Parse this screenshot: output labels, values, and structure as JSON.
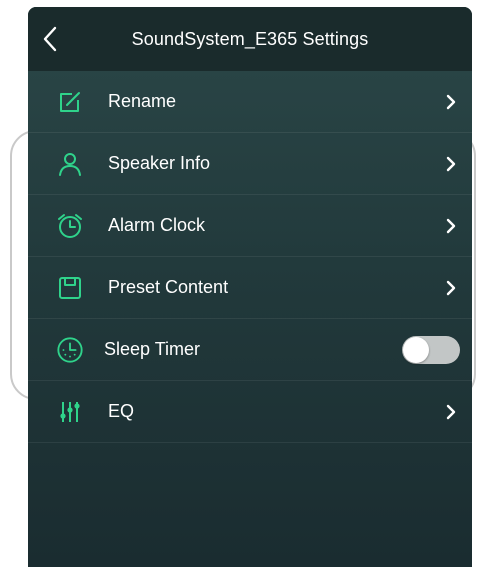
{
  "header": {
    "back_icon": "chevron-left-icon",
    "title": "SoundSystem_E365 Settings"
  },
  "accent_color": "#2fd38b",
  "items": [
    {
      "label": "Rename",
      "icon": "edit-icon",
      "control": "chevron"
    },
    {
      "label": "Speaker Info",
      "icon": "person-icon",
      "control": "chevron"
    },
    {
      "label": "Alarm Clock",
      "icon": "alarm-clock-icon",
      "control": "chevron"
    },
    {
      "label": "Preset Content",
      "icon": "save-icon",
      "control": "chevron"
    },
    {
      "label": "Sleep Timer",
      "icon": "timer-icon",
      "control": "toggle",
      "enabled": false
    },
    {
      "label": "EQ",
      "icon": "equalizer-icon",
      "control": "chevron"
    }
  ]
}
